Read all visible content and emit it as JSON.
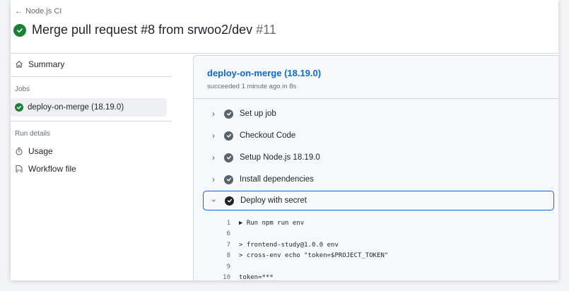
{
  "header": {
    "back_label": "Node.js CI",
    "title": "Merge pull request #8 from srwoo2/dev",
    "run_number": "#11",
    "status_color": "#1a7f37"
  },
  "sidebar": {
    "summary_label": "Summary",
    "jobs_heading": "Jobs",
    "selected_job": "deploy-on-merge (18.19.0)",
    "run_details_heading": "Run details",
    "usage_label": "Usage",
    "workflow_label": "Workflow file"
  },
  "job": {
    "name": "deploy-on-merge (18.19.0)",
    "meta": "succeeded 1 minute ago in 8s"
  },
  "steps": [
    {
      "label": "Set up job",
      "expanded": false
    },
    {
      "label": "Checkout Code",
      "expanded": false
    },
    {
      "label": "Setup Node.js 18.19.0",
      "expanded": false
    },
    {
      "label": "Install dependencies",
      "expanded": false
    },
    {
      "label": "Deploy with secret",
      "expanded": true
    }
  ],
  "log": [
    {
      "n": "1",
      "text": "▶ Run npm run env"
    },
    {
      "n": "6",
      "text": ""
    },
    {
      "n": "7",
      "text": "> frontend-study@1.0.0 env"
    },
    {
      "n": "8",
      "text": "> cross-env echo \"token=$PROJECT_TOKEN\""
    },
    {
      "n": "9",
      "text": ""
    },
    {
      "n": "10",
      "text": "token=***"
    }
  ],
  "icons": {
    "back": "arrow-left-icon",
    "summary": "home-icon",
    "usage": "stopwatch-icon",
    "workflow": "file-code-icon",
    "step_status": "check-circle-icon"
  }
}
